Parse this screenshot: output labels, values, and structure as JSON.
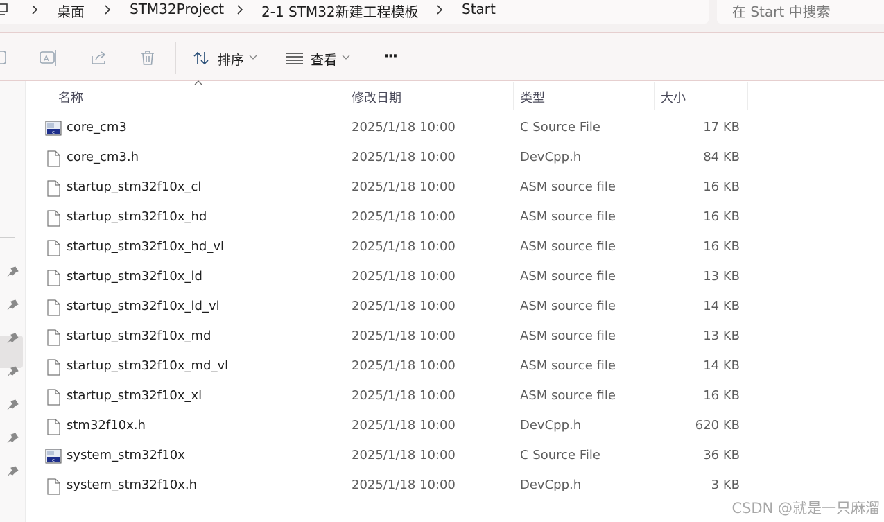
{
  "breadcrumb": {
    "items": [
      "桌面",
      "STM32Project",
      "2-1 STM32新建工程模板",
      "Start"
    ]
  },
  "search": {
    "placeholder": "在 Start 中搜索"
  },
  "toolbar": {
    "sort_label": "排序",
    "view_label": "查看",
    "more_label": "···"
  },
  "columns": {
    "name": "名称",
    "date": "修改日期",
    "type": "类型",
    "size": "大小"
  },
  "files": [
    {
      "name": "core_cm3",
      "date": "2025/1/18 10:00",
      "type": "C Source File",
      "size": "17 KB",
      "icon": "c-source-icon"
    },
    {
      "name": "core_cm3.h",
      "date": "2025/1/18 10:00",
      "type": "DevCpp.h",
      "size": "84 KB",
      "icon": "file-icon"
    },
    {
      "name": "startup_stm32f10x_cl",
      "date": "2025/1/18 10:00",
      "type": "ASM source file",
      "size": "16 KB",
      "icon": "file-icon"
    },
    {
      "name": "startup_stm32f10x_hd",
      "date": "2025/1/18 10:00",
      "type": "ASM source file",
      "size": "16 KB",
      "icon": "file-icon"
    },
    {
      "name": "startup_stm32f10x_hd_vl",
      "date": "2025/1/18 10:00",
      "type": "ASM source file",
      "size": "16 KB",
      "icon": "file-icon"
    },
    {
      "name": "startup_stm32f10x_ld",
      "date": "2025/1/18 10:00",
      "type": "ASM source file",
      "size": "13 KB",
      "icon": "file-icon"
    },
    {
      "name": "startup_stm32f10x_ld_vl",
      "date": "2025/1/18 10:00",
      "type": "ASM source file",
      "size": "14 KB",
      "icon": "file-icon"
    },
    {
      "name": "startup_stm32f10x_md",
      "date": "2025/1/18 10:00",
      "type": "ASM source file",
      "size": "13 KB",
      "icon": "file-icon"
    },
    {
      "name": "startup_stm32f10x_md_vl",
      "date": "2025/1/18 10:00",
      "type": "ASM source file",
      "size": "14 KB",
      "icon": "file-icon"
    },
    {
      "name": "startup_stm32f10x_xl",
      "date": "2025/1/18 10:00",
      "type": "ASM source file",
      "size": "16 KB",
      "icon": "file-icon"
    },
    {
      "name": "stm32f10x.h",
      "date": "2025/1/18 10:00",
      "type": "DevCpp.h",
      "size": "620 KB",
      "icon": "file-icon"
    },
    {
      "name": "system_stm32f10x",
      "date": "2025/1/18 10:00",
      "type": "C Source File",
      "size": "36 KB",
      "icon": "c-source-icon"
    },
    {
      "name": "system_stm32f10x.h",
      "date": "2025/1/18 10:00",
      "type": "DevCpp.h",
      "size": "3 KB",
      "icon": "file-icon"
    }
  ],
  "watermark": "CSDN @就是一只麻溜"
}
